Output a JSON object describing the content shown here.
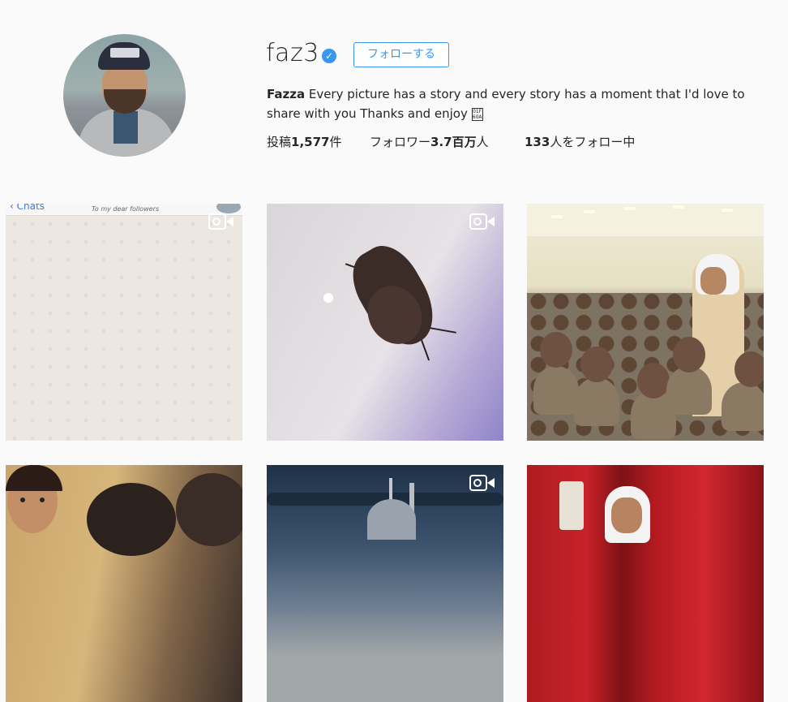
{
  "profile": {
    "username": "faz3",
    "verified_icon": "verified-badge-icon",
    "follow_label": "フォローする",
    "display_name": "Fazza",
    "bio_text": " Every picture has a story and every story has a moment that I'd love to share with you Thanks and enjoy ",
    "bio_emoji_chars": "01F 60A"
  },
  "stats": {
    "posts_prefix": "投稿",
    "posts_value": "1,577",
    "posts_suffix": "件",
    "followers_prefix": "フォロワー",
    "followers_value": "3.7百万",
    "followers_suffix": "人",
    "following_value": "133",
    "following_suffix": "人をフォロー中"
  },
  "grid": {
    "tile1": {
      "chats_label": "Chats",
      "chat_title": "To my dear followers",
      "type": "video"
    },
    "tile2": {
      "type": "video"
    },
    "tile3": {
      "type": "photo"
    },
    "tile4": {
      "type": "photo"
    },
    "tile5": {
      "type": "video"
    },
    "tile6": {
      "type": "photo"
    }
  },
  "colors": {
    "accent": "#3897f0",
    "background": "#fafafa",
    "text": "#262626"
  }
}
